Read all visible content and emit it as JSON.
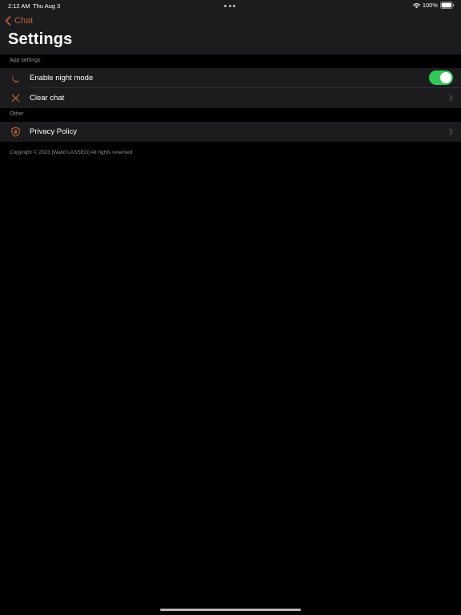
{
  "status_bar": {
    "time": "2:12 AM",
    "date": "Thu Aug 3",
    "battery": "100%"
  },
  "nav": {
    "back_label": "Chat",
    "title": "Settings"
  },
  "sections": [
    {
      "header": "App settings",
      "rows": [
        {
          "label": "Enable night mode",
          "icon": "moon-icon",
          "toggle_on": true
        },
        {
          "label": "Clear chat",
          "icon": "close-icon",
          "chevron": true
        }
      ]
    },
    {
      "header": "Other",
      "rows": [
        {
          "label": "Privacy Policy",
          "icon": "shield-icon",
          "chevron": true
        }
      ]
    }
  ],
  "footer": {
    "copyright": "Copyright © 2023 [Walid LASSEG] All rights reserved"
  },
  "colors": {
    "accent": "#b8653a",
    "toggle_on": "#33c759",
    "row_background": "#1c1c1e",
    "page_background": "#000000",
    "secondary_text": "#8e8e93"
  }
}
